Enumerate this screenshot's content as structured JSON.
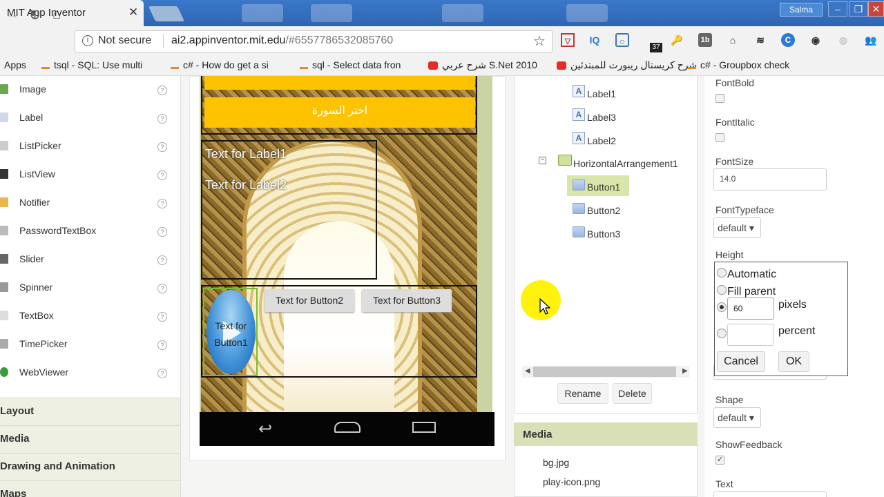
{
  "browser": {
    "tab_title": "MIT App Inventor",
    "tab_close": "✕",
    "user": "Salma",
    "security": "Not secure",
    "url_host": "ai2.appinventor.mit.edu",
    "url_rest": "/#6557786532085760",
    "ext_badge": "37",
    "bookmarks": [
      {
        "label": "Apps",
        "icon": "apps-icon"
      },
      {
        "label": "tsql - SQL: Use multi",
        "icon": "stackoverflow-icon"
      },
      {
        "label": "c# - How do get a si",
        "icon": "stackoverflow-icon"
      },
      {
        "label": "sql - Select data fron",
        "icon": "stackoverflow-icon"
      },
      {
        "label": "شرح عربي S.Net 2010",
        "icon": "youtube-icon"
      },
      {
        "label": "شرح كريستال ريبورت للمبتدئين",
        "icon": "youtube-icon"
      },
      {
        "label": "c# - Groupbox check",
        "icon": "stackoverflow-icon"
      }
    ]
  },
  "palette": {
    "items": [
      "Image",
      "Label",
      "ListPicker",
      "ListView",
      "Notifier",
      "PasswordTextBox",
      "Slider",
      "Spinner",
      "TextBox",
      "TimePicker",
      "WebViewer"
    ],
    "help": "?",
    "categories": [
      "Layout",
      "Media",
      "Drawing and Animation",
      "Maps"
    ]
  },
  "viewer": {
    "surah_button": "اختر السورة",
    "label1": "Text for Label1",
    "label2": "Text for Label2",
    "button1_line1": "Text for",
    "button1_line2": "Button1",
    "button2": "Text for Button2",
    "button3": "Text for Button3"
  },
  "components": {
    "tree": [
      {
        "label": "Label1",
        "type": "label"
      },
      {
        "label": "Label3",
        "type": "label"
      },
      {
        "label": "Label2",
        "type": "label"
      },
      {
        "label": "HorizontalArrangement1",
        "type": "arrangement"
      },
      {
        "label": "Button1",
        "type": "button",
        "selected": true
      },
      {
        "label": "Button2",
        "type": "button"
      },
      {
        "label": "Button3",
        "type": "button"
      }
    ],
    "rename": "Rename",
    "delete": "Delete"
  },
  "media": {
    "title": "Media",
    "files": [
      "bg.jpg",
      "play-icon.png"
    ]
  },
  "properties": {
    "fontbold_label": "FontBold",
    "fontitalic_label": "FontItalic",
    "fontsize_label": "FontSize",
    "fontsize_value": "14.0",
    "fonttypeface_label": "FontTypeface",
    "fonttypeface_value": "default ▾",
    "height_label": "Height",
    "height_popup": {
      "automatic": "Automatic",
      "fill_parent": "Fill parent",
      "pixels_value": "60",
      "pixels": "pixels",
      "percent": "percent",
      "cancel": "Cancel",
      "ok": "OK"
    },
    "shape_label": "Shape",
    "shape_value": "default ▾",
    "showfeedback_label": "ShowFeedback",
    "text_label": "Text"
  },
  "colors": {
    "accent_green": "#d9e6a9",
    "button_yellow": "#fdc300",
    "cursor_highlight": "#fff200"
  }
}
